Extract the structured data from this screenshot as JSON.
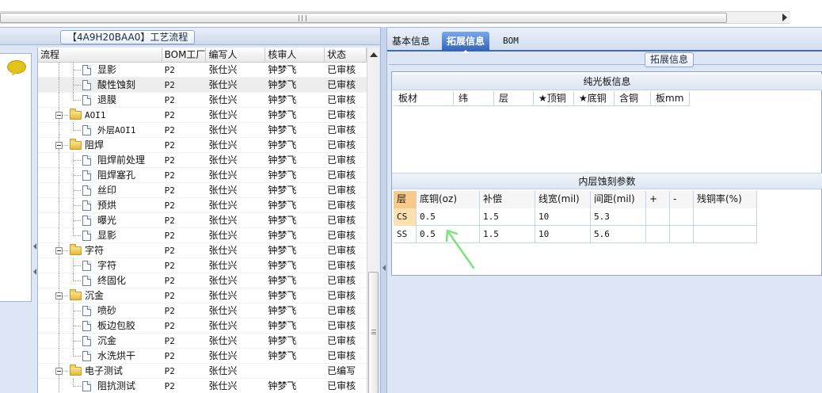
{
  "left_panel": {
    "title": "【4A9H20BAA0】工艺流程",
    "columns": [
      "流程",
      "BOM工厂",
      "编写人",
      "核审人",
      "状态"
    ],
    "rows": [
      {
        "name": "显影",
        "level": 2,
        "type": "doc",
        "bom": "P2",
        "writer": "张仕兴",
        "reviewer": "钟梦飞",
        "status": "已审核",
        "selected": false
      },
      {
        "name": "酸性蚀刻",
        "level": 2,
        "type": "doc",
        "bom": "P2",
        "writer": "张仕兴",
        "reviewer": "钟梦飞",
        "status": "已审核",
        "selected": true
      },
      {
        "name": "退膜",
        "level": 2,
        "type": "doc",
        "bom": "P2",
        "writer": "张仕兴",
        "reviewer": "钟梦飞",
        "status": "已审核",
        "selected": false
      },
      {
        "name": "AOI1",
        "level": 1,
        "type": "folder",
        "bom": "P2",
        "writer": "张仕兴",
        "reviewer": "钟梦飞",
        "status": "已审核",
        "selected": false
      },
      {
        "name": "外层AOI1",
        "level": 2,
        "type": "doc",
        "bom": "P2",
        "writer": "张仕兴",
        "reviewer": "钟梦飞",
        "status": "已审核",
        "selected": false
      },
      {
        "name": "阻焊",
        "level": 1,
        "type": "folder",
        "bom": "P2",
        "writer": "张仕兴",
        "reviewer": "钟梦飞",
        "status": "已审核",
        "selected": false
      },
      {
        "name": "阻焊前处理",
        "level": 2,
        "type": "doc",
        "bom": "P2",
        "writer": "张仕兴",
        "reviewer": "钟梦飞",
        "status": "已审核",
        "selected": false
      },
      {
        "name": "阻焊塞孔",
        "level": 2,
        "type": "doc",
        "bom": "P2",
        "writer": "张仕兴",
        "reviewer": "钟梦飞",
        "status": "已审核",
        "selected": false
      },
      {
        "name": "丝印",
        "level": 2,
        "type": "doc",
        "bom": "P2",
        "writer": "张仕兴",
        "reviewer": "钟梦飞",
        "status": "已审核",
        "selected": false
      },
      {
        "name": "预烘",
        "level": 2,
        "type": "doc",
        "bom": "P2",
        "writer": "张仕兴",
        "reviewer": "钟梦飞",
        "status": "已审核",
        "selected": false
      },
      {
        "name": "曝光",
        "level": 2,
        "type": "doc",
        "bom": "P2",
        "writer": "张仕兴",
        "reviewer": "钟梦飞",
        "status": "已审核",
        "selected": false
      },
      {
        "name": "显影",
        "level": 2,
        "type": "doc",
        "bom": "P2",
        "writer": "张仕兴",
        "reviewer": "钟梦飞",
        "status": "已审核",
        "selected": false
      },
      {
        "name": "字符",
        "level": 1,
        "type": "folder",
        "bom": "P2",
        "writer": "张仕兴",
        "reviewer": "钟梦飞",
        "status": "已审核",
        "selected": false
      },
      {
        "name": "字符",
        "level": 2,
        "type": "doc",
        "bom": "P2",
        "writer": "张仕兴",
        "reviewer": "钟梦飞",
        "status": "已审核",
        "selected": false
      },
      {
        "name": "终固化",
        "level": 2,
        "type": "doc",
        "bom": "P2",
        "writer": "张仕兴",
        "reviewer": "钟梦飞",
        "status": "已审核",
        "selected": false
      },
      {
        "name": "沉金",
        "level": 1,
        "type": "folder",
        "bom": "P2",
        "writer": "张仕兴",
        "reviewer": "钟梦飞",
        "status": "已审核",
        "selected": false
      },
      {
        "name": "喷砂",
        "level": 2,
        "type": "doc",
        "bom": "P2",
        "writer": "张仕兴",
        "reviewer": "钟梦飞",
        "status": "已审核",
        "selected": false
      },
      {
        "name": "板边包胶",
        "level": 2,
        "type": "doc",
        "bom": "P2",
        "writer": "张仕兴",
        "reviewer": "钟梦飞",
        "status": "已审核",
        "selected": false
      },
      {
        "name": "沉金",
        "level": 2,
        "type": "doc",
        "bom": "P2",
        "writer": "张仕兴",
        "reviewer": "钟梦飞",
        "status": "已审核",
        "selected": false
      },
      {
        "name": "水洗烘干",
        "level": 2,
        "type": "doc",
        "bom": "P2",
        "writer": "张仕兴",
        "reviewer": "钟梦飞",
        "status": "已审核",
        "selected": false
      },
      {
        "name": "电子测试",
        "level": 1,
        "type": "folder",
        "bom": "P2",
        "writer": "张仕兴",
        "reviewer": "",
        "status": "已编写",
        "selected": false
      },
      {
        "name": "阻抗测试",
        "level": 2,
        "type": "doc",
        "bom": "P2",
        "writer": "张仕兴",
        "reviewer": "钟梦飞",
        "status": "已审核",
        "selected": false
      }
    ]
  },
  "right_panel": {
    "tabs": [
      {
        "label": "基本信息",
        "active": false
      },
      {
        "label": "拓展信息",
        "active": true
      },
      {
        "label": "BOM",
        "active": false
      }
    ],
    "group_title": "拓展信息",
    "section1": {
      "title": "纯光板信息",
      "columns": [
        "板材",
        "纬",
        "层",
        "★顶铜",
        "★底铜",
        "含铜",
        "板mm"
      ]
    },
    "section2": {
      "title": "内层蚀刻参数",
      "columns": [
        "层",
        "底铜(oz)",
        "补偿",
        "线宽(mil)",
        "间距(mil)",
        "+",
        "-",
        "残铜率(%)"
      ],
      "rows": [
        {
          "layer": "CS",
          "base_copper": "0.5",
          "comp": "1.5",
          "width": "10",
          "spacing": "5.3",
          "plus": "",
          "minus": "",
          "residual": ""
        },
        {
          "layer": "SS",
          "base_copper": "0.5",
          "comp": "1.5",
          "width": "10",
          "spacing": "5.6",
          "plus": "",
          "minus": "",
          "residual": ""
        }
      ]
    }
  },
  "colors": {
    "panel_bg": "#dce6f4",
    "active_tab": "#2f62b8",
    "highlight_layer": "#f9c98a",
    "annotation_arrow": "#7ee07e"
  }
}
